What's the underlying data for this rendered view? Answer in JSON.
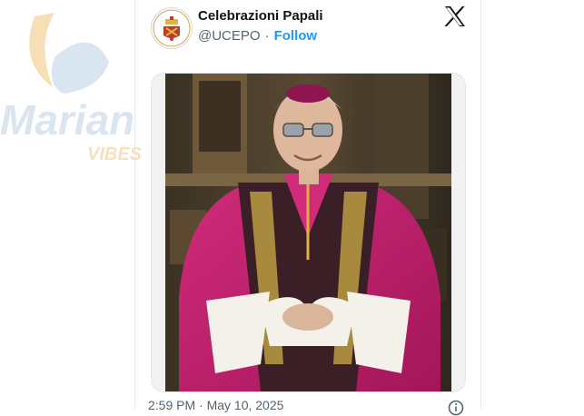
{
  "account": {
    "display_name": "Celebrazioni Papali",
    "handle": "@UCEPO",
    "separator": "·",
    "follow_label": "Follow"
  },
  "tweet": {
    "timestamp": "2:59 PM · May 10, 2025",
    "media_icon": "photo",
    "info_icon": "info-icon"
  },
  "brand": {
    "platform_icon": "x-logo-icon",
    "watermark": {
      "word": "Marian",
      "sub": "VIBES",
      "word_color": "#d8e3ee",
      "sub_color": "#f6ddb8"
    }
  },
  "colors": {
    "accent": "#1d9bf0",
    "text_primary": "#0f1419",
    "text_secondary": "#536471",
    "vestment_magenta": "#c21e6e"
  }
}
